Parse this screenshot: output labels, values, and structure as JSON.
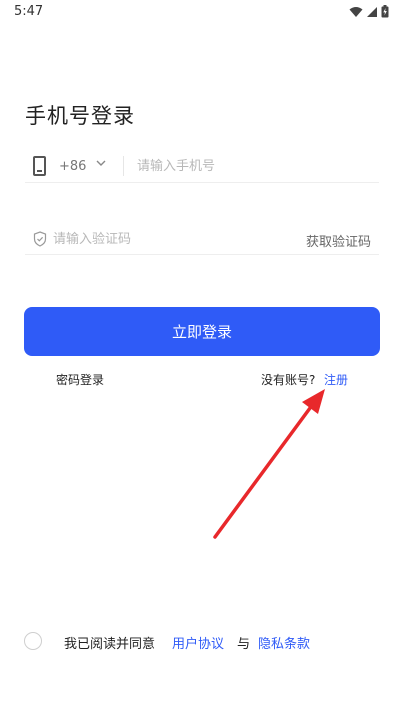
{
  "status_bar": {
    "time": "5:47"
  },
  "title": "手机号登录",
  "phone": {
    "country_code": "+86",
    "placeholder": "请输入手机号"
  },
  "code": {
    "placeholder": "请输入验证码",
    "get_code_label": "获取验证码"
  },
  "login_button": "立即登录",
  "password_login": "密码登录",
  "no_account": "没有账号?",
  "register": "注册",
  "agreement": {
    "text": "我已阅读并同意",
    "user_agreement": "用户协议",
    "and": "与",
    "privacy_policy": "隐私条款"
  },
  "colors": {
    "accent": "#2f5bf7",
    "annotation_arrow": "#e8282b"
  }
}
